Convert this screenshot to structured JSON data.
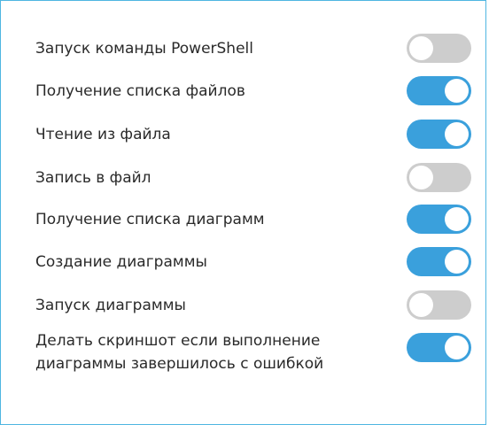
{
  "settings": [
    {
      "label": "Запуск команды PowerShell",
      "enabled": false
    },
    {
      "label": "Получение списка файлов",
      "enabled": true
    },
    {
      "label": "Чтение из файла",
      "enabled": true
    },
    {
      "label": "Запись в файл",
      "enabled": false
    },
    {
      "label": "Получение списка диаграмм",
      "enabled": true
    },
    {
      "label": "Создание диаграммы",
      "enabled": true
    },
    {
      "label": "Запуск диаграммы",
      "enabled": false
    },
    {
      "label_line1": "Делать скриншот если выполнение",
      "label_line2": "диаграммы завершилось с ошибкой",
      "enabled": true
    }
  ],
  "colors": {
    "border": "#4fb6e1",
    "toggle_on": "#3aa0dc",
    "toggle_off": "#cdcdcd"
  }
}
